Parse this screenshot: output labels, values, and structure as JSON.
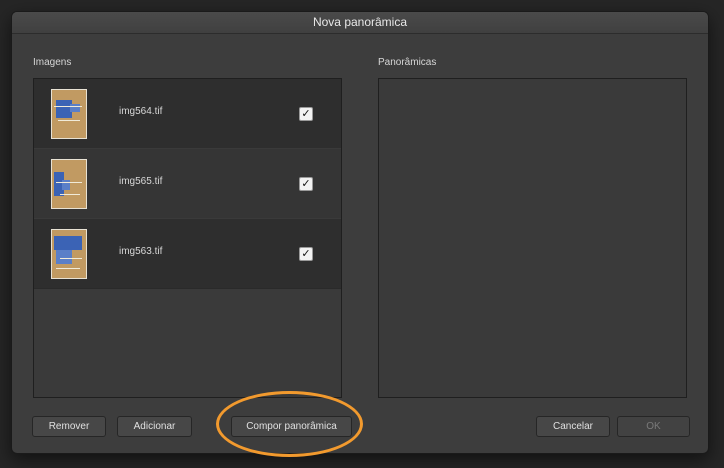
{
  "dialog": {
    "title": "Nova panorâmica"
  },
  "images_section": {
    "label": "Imagens",
    "items": [
      {
        "filename": "img564.tif",
        "checked": true,
        "check_mark": "✓"
      },
      {
        "filename": "img565.tif",
        "checked": true,
        "check_mark": "✓"
      },
      {
        "filename": "img563.tif",
        "checked": true,
        "check_mark": "✓"
      }
    ]
  },
  "panoramas_section": {
    "label": "Panorâmicas"
  },
  "buttons": {
    "remove": "Remover",
    "add": "Adicionar",
    "compose": "Compor panorâmica",
    "cancel": "Cancelar",
    "ok": "OK"
  },
  "colors": {
    "highlight": "#f29a2e",
    "dialog_bg": "#3d3d3d"
  }
}
